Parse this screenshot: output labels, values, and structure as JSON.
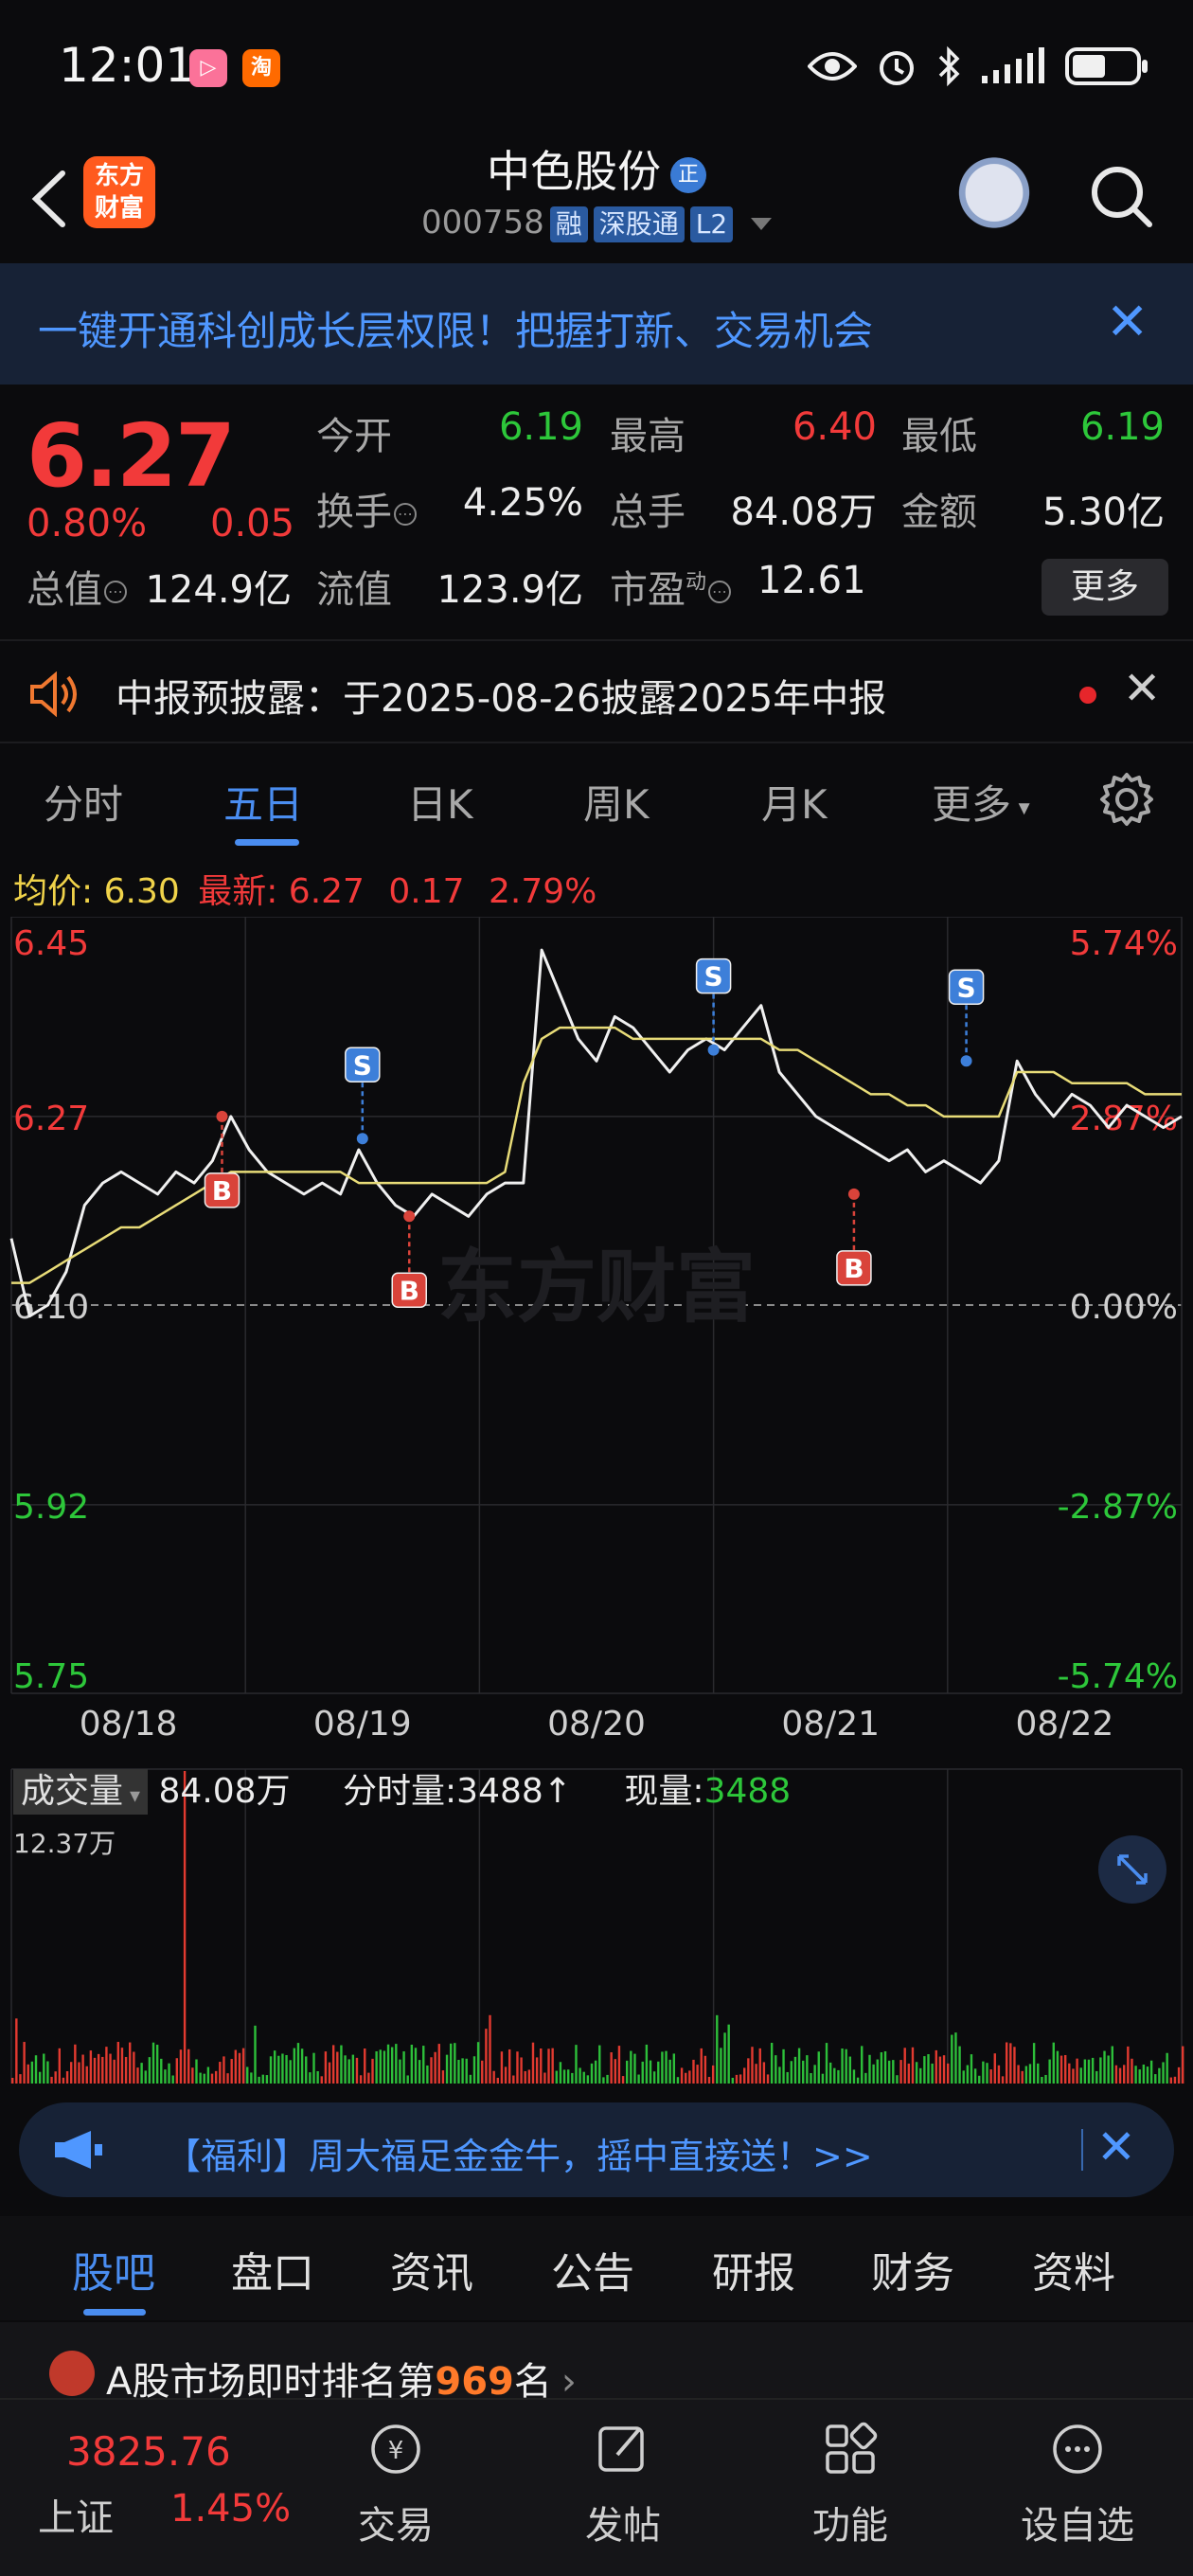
{
  "status_bar": {
    "time": "12:01",
    "app_badges": [
      "bilibili",
      "淘"
    ]
  },
  "header": {
    "logo_text": "东方财富",
    "stock_name": "中色股份",
    "name_badge": "正",
    "stock_code": "000758",
    "tags": [
      "融",
      "深股通",
      "L2"
    ]
  },
  "banner": {
    "text": "一键开通科创成长层权限！把握打新、交易机会"
  },
  "quote": {
    "price": "6.27",
    "change_pct": "0.80%",
    "change": "0.05",
    "open_label": "今开",
    "open": "6.19",
    "high_label": "最高",
    "high": "6.40",
    "low_label": "最低",
    "low": "6.19",
    "turnover_label": "换手",
    "turnover": "4.25%",
    "volume_label": "总手",
    "volume": "84.08万",
    "amount_label": "金额",
    "amount": "5.30亿",
    "mktcap_label": "总值",
    "mktcap": "124.9亿",
    "float_label": "流值",
    "float": "123.9亿",
    "pe_label": "市盈",
    "pe_sup": "动",
    "pe": "12.61",
    "more_button": "更多"
  },
  "notice": {
    "text": "中报预披露：于2025-08-26披露2025年中报"
  },
  "period_tabs": [
    "分时",
    "五日",
    "日K",
    "周K",
    "月K",
    "更多"
  ],
  "period_active": 1,
  "chart_summary": {
    "avg_label": "均价:",
    "avg": "6.30",
    "latest_label": "最新:",
    "latest": "6.27",
    "chg": "0.17",
    "chg_pct": "2.79%"
  },
  "chart_data": {
    "type": "line",
    "title": "",
    "y_left_ticks": [
      "6.45",
      "6.27",
      "6.10",
      "5.92",
      "5.75"
    ],
    "y_right_ticks": [
      "5.74%",
      "2.87%",
      "0.00%",
      "-2.87%",
      "-5.74%"
    ],
    "ylim": [
      5.75,
      6.45
    ],
    "prev_close": 6.1,
    "x_labels": [
      "08/18",
      "08/19",
      "08/20",
      "08/21",
      "08/22"
    ],
    "watermark": "东方财富",
    "series": [
      {
        "name": "price",
        "color": "#f0f0f0",
        "values": [
          6.16,
          6.09,
          6.1,
          6.13,
          6.19,
          6.21,
          6.22,
          6.21,
          6.2,
          6.22,
          6.21,
          6.23,
          6.27,
          6.24,
          6.22,
          6.21,
          6.2,
          6.21,
          6.2,
          6.24,
          6.21,
          6.19,
          6.18,
          6.2,
          6.19,
          6.18,
          6.2,
          6.21,
          6.21,
          6.42,
          6.38,
          6.34,
          6.32,
          6.36,
          6.35,
          6.33,
          6.31,
          6.33,
          6.34,
          6.33,
          6.35,
          6.37,
          6.31,
          6.29,
          6.27,
          6.26,
          6.25,
          6.24,
          6.23,
          6.24,
          6.22,
          6.23,
          6.22,
          6.21,
          6.23,
          6.32,
          6.29,
          6.27,
          6.29,
          6.28,
          6.26,
          6.28,
          6.27,
          6.26,
          6.27
        ]
      },
      {
        "name": "avg",
        "color": "#e8dc78",
        "values": [
          6.12,
          6.12,
          6.13,
          6.14,
          6.15,
          6.16,
          6.17,
          6.17,
          6.18,
          6.19,
          6.2,
          6.21,
          6.22,
          6.22,
          6.22,
          6.22,
          6.22,
          6.22,
          6.22,
          6.21,
          6.21,
          6.21,
          6.21,
          6.21,
          6.21,
          6.21,
          6.21,
          6.22,
          6.3,
          6.34,
          6.35,
          6.35,
          6.35,
          6.35,
          6.34,
          6.34,
          6.34,
          6.34,
          6.34,
          6.34,
          6.34,
          6.34,
          6.33,
          6.33,
          6.32,
          6.31,
          6.3,
          6.29,
          6.29,
          6.28,
          6.28,
          6.27,
          6.27,
          6.27,
          6.27,
          6.31,
          6.31,
          6.31,
          6.3,
          6.3,
          6.3,
          6.3,
          6.29,
          6.29,
          6.29
        ]
      }
    ],
    "markers": [
      {
        "type": "B",
        "day": 0,
        "pos": 0.9,
        "price": 6.27
      },
      {
        "type": "S",
        "day": 1,
        "pos": 0.5,
        "price": 6.25
      },
      {
        "type": "B",
        "day": 1,
        "pos": 0.7,
        "price": 6.18
      },
      {
        "type": "S",
        "day": 2,
        "pos": 1.0,
        "price": 6.33
      },
      {
        "type": "B",
        "day": 3,
        "pos": 0.6,
        "price": 6.2
      },
      {
        "type": "S",
        "day": 4,
        "pos": 0.08,
        "price": 6.32
      }
    ]
  },
  "volume": {
    "label": "成交量",
    "total": "84.08万",
    "tick_label": "分时量:",
    "tick_value": "3488",
    "tick_arrow": "↑",
    "now_label": "现量:",
    "now_value": "3488",
    "max_label": "12.37万"
  },
  "promo": {
    "text": "【福利】周大福足金金牛，摇中直接送！>>"
  },
  "info_tabs": [
    "股吧",
    "盘口",
    "资讯",
    "公告",
    "研报",
    "财务",
    "资料"
  ],
  "info_active": 0,
  "rank": {
    "prefix": "A股市场即时排名第",
    "number": "969",
    "suffix": "名"
  },
  "bottom_nav": {
    "index_value": "3825.76",
    "index_name": "上证",
    "index_pct": "1.45%",
    "items": [
      "交易",
      "发帖",
      "功能",
      "设自选"
    ]
  },
  "colors": {
    "up": "#f23a3a",
    "down": "#2dc73a",
    "accent": "#4a8df0",
    "price_line": "#f0f0f0",
    "avg_line": "#e8dc78"
  }
}
